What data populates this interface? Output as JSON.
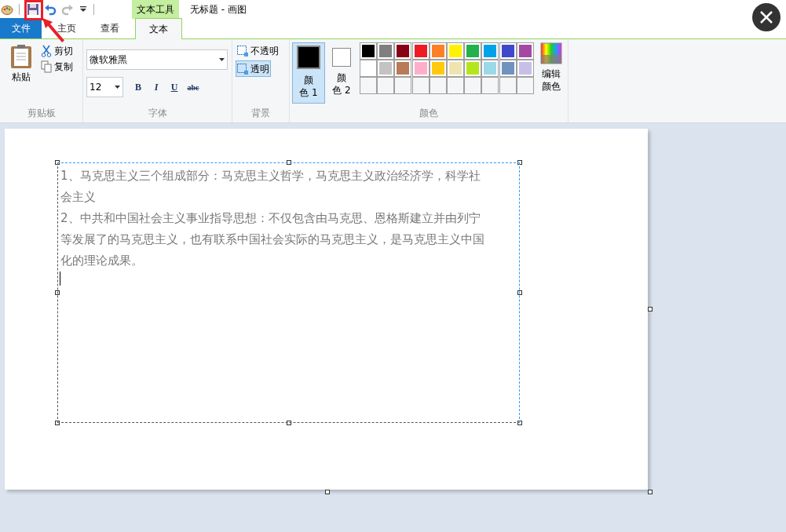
{
  "window": {
    "title": "无标题 - 画图",
    "context_tab": "文本工具"
  },
  "tabs": [
    {
      "label": "文件",
      "kind": "file",
      "selected": false
    },
    {
      "label": "主页",
      "kind": "tab",
      "selected": false
    },
    {
      "label": "查看",
      "kind": "tab",
      "selected": false
    },
    {
      "label": "文本",
      "kind": "tab",
      "selected": true
    }
  ],
  "clipboard": {
    "paste": "粘贴",
    "cut": "剪切",
    "copy": "复制",
    "group_label": "剪贴板"
  },
  "font": {
    "family": "微软雅黑",
    "size": "12",
    "bold": "B",
    "italic": "I",
    "underline": "U",
    "strike": "abc",
    "group_label": "字体"
  },
  "background": {
    "options": [
      {
        "label": "不透明",
        "selected": false
      },
      {
        "label": "透明",
        "selected": true
      }
    ],
    "group_label": "背景"
  },
  "colors": {
    "color1": {
      "label_lines": [
        "颜",
        "色 1"
      ],
      "color": "#000000",
      "selected": true
    },
    "color2": {
      "label_lines": [
        "颜",
        "色 2"
      ],
      "color": "#ffffff",
      "selected": false
    },
    "palette": [
      {
        "color": "#000000"
      },
      {
        "color": "#7f7f7f"
      },
      {
        "color": "#880015"
      },
      {
        "color": "#ed1c24"
      },
      {
        "color": "#ff7f27"
      },
      {
        "color": "#fff200"
      },
      {
        "color": "#22b14c"
      },
      {
        "color": "#00a2e8"
      },
      {
        "color": "#3f48cc"
      },
      {
        "color": "#a349a4"
      },
      {
        "color": "#ffffff"
      },
      {
        "color": "#c3c3c3"
      },
      {
        "color": "#b97a57"
      },
      {
        "color": "#ffaec9"
      },
      {
        "color": "#ffc90e"
      },
      {
        "color": "#efe4b0"
      },
      {
        "color": "#b5e61d"
      },
      {
        "color": "#99d9ea"
      },
      {
        "color": "#7092be"
      },
      {
        "color": "#c8bfe7"
      }
    ],
    "edit_lines": [
      "编辑",
      "颜色"
    ],
    "group_label": "颜色"
  },
  "text_box": {
    "lines": [
      "1、马克思主义三个组成部分：马克思主义哲学，马克思主义政治经济学，科学社",
      "会主义",
      "2、中共和中国社会主义事业指导思想：不仅包含由马克思、恩格斯建立并由列宁",
      "等发展了的马克思主义，也有联系中国社会实际的马克思主义，是马克思主义中国",
      "化的理论成果。"
    ]
  }
}
